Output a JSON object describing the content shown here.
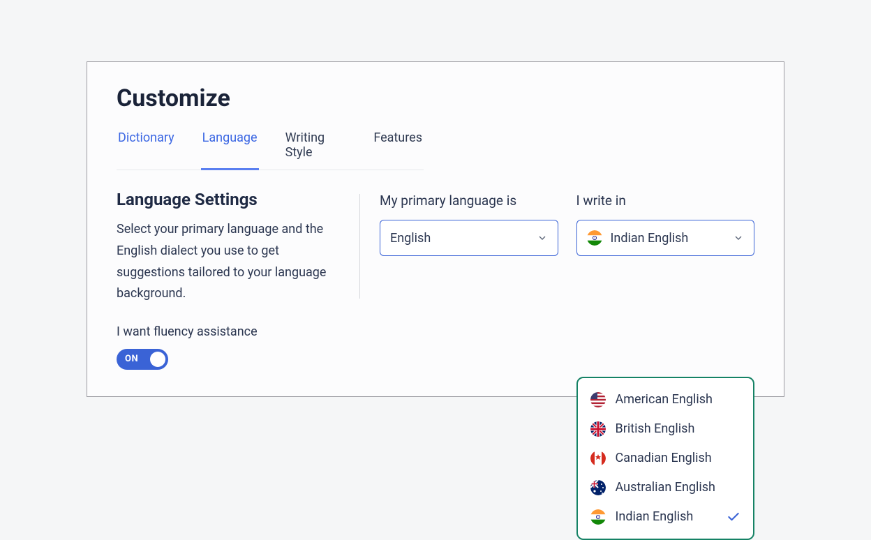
{
  "title": "Customize",
  "tabs": [
    {
      "label": "Dictionary",
      "active": false,
      "link": true
    },
    {
      "label": "Language",
      "active": true,
      "link": true
    },
    {
      "label": "Writing Style",
      "active": false,
      "link": false
    },
    {
      "label": "Features",
      "active": false,
      "link": false
    }
  ],
  "section": {
    "heading": "Language Settings",
    "description": "Select your primary language and the English dialect you use to get suggestions tailored to your language background.",
    "fluency_label": "I want fluency assistance",
    "toggle_state": "ON"
  },
  "primary": {
    "label": "My primary language is",
    "value": "English"
  },
  "dialect": {
    "label": "I write in",
    "value": "Indian English",
    "flag": "in",
    "options": [
      {
        "label": "American English",
        "flag": "us",
        "selected": false
      },
      {
        "label": "British English",
        "flag": "uk",
        "selected": false
      },
      {
        "label": "Canadian English",
        "flag": "ca",
        "selected": false
      },
      {
        "label": "Australian English",
        "flag": "au",
        "selected": false
      },
      {
        "label": "Indian English",
        "flag": "in",
        "selected": true
      }
    ]
  }
}
